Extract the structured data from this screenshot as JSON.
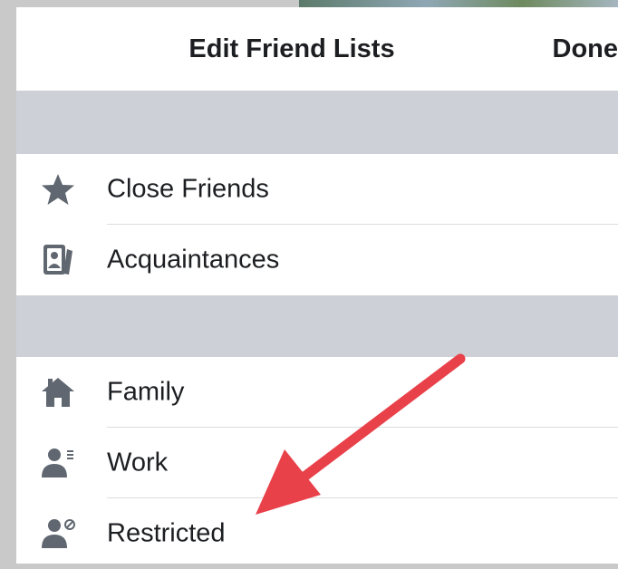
{
  "header": {
    "title": "Edit Friend Lists",
    "done_label": "Done"
  },
  "lists": [
    {
      "label": "Close Friends",
      "icon": "star-icon"
    },
    {
      "label": "Acquaintances",
      "icon": "contact-card-icon"
    },
    {
      "label": "Family",
      "icon": "house-icon"
    },
    {
      "label": "Work",
      "icon": "person-list-icon"
    },
    {
      "label": "Restricted",
      "icon": "person-restricted-icon"
    }
  ],
  "colors": {
    "icon": "#606770",
    "text": "#1c1e21",
    "section_gap": "#cdd0d6",
    "arrow": "#e8414a"
  }
}
